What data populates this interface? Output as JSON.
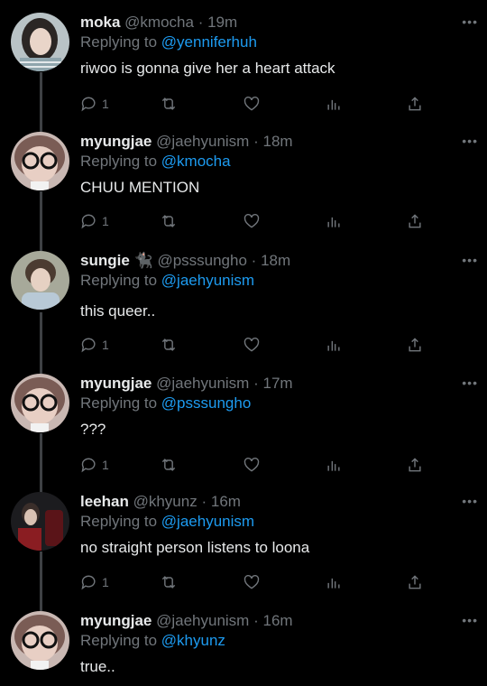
{
  "tweets": [
    {
      "name": "moka",
      "emoji": "",
      "handle": "@kmocha",
      "time": "19m",
      "replying_label": "Replying to",
      "replying_to": "@yenniferhuh",
      "text": "riwoo is gonna give her a heart attack",
      "reply_count": "1",
      "more": "•••"
    },
    {
      "name": "myungjae",
      "emoji": "",
      "handle": "@jaehyunism",
      "time": "18m",
      "replying_label": "Replying to",
      "replying_to": "@kmocha",
      "text": "CHUU MENTION",
      "reply_count": "1",
      "more": "•••"
    },
    {
      "name": "sungie",
      "emoji": "🐈‍⬛",
      "handle": "@psssungho",
      "time": "18m",
      "replying_label": "Replying to",
      "replying_to": "@jaehyunism",
      "text": "this queer..",
      "reply_count": "1",
      "more": "•••"
    },
    {
      "name": "myungjae",
      "emoji": "",
      "handle": "@jaehyunism",
      "time": "17m",
      "replying_label": "Replying to",
      "replying_to": "@psssungho",
      "text": "???",
      "reply_count": "1",
      "more": "•••"
    },
    {
      "name": "leehan",
      "emoji": "",
      "handle": "@khyunz",
      "time": "16m",
      "replying_label": "Replying to",
      "replying_to": "@jaehyunism",
      "text": "no straight person listens to loona",
      "reply_count": "1",
      "more": "•••"
    },
    {
      "name": "myungjae",
      "emoji": "",
      "handle": "@jaehyunism",
      "time": "16m",
      "replying_label": "Replying to",
      "replying_to": "@khyunz",
      "text": "true..",
      "reply_count": "",
      "more": "•••"
    }
  ],
  "separator": "·",
  "icons": [
    "reply-icon",
    "retweet-icon",
    "like-icon",
    "views-icon",
    "share-icon"
  ],
  "colors": {
    "background": "#000000",
    "text": "#e7e9ea",
    "muted": "#71767b",
    "link": "#1d9bf0",
    "thread_line": "#3e4144"
  }
}
